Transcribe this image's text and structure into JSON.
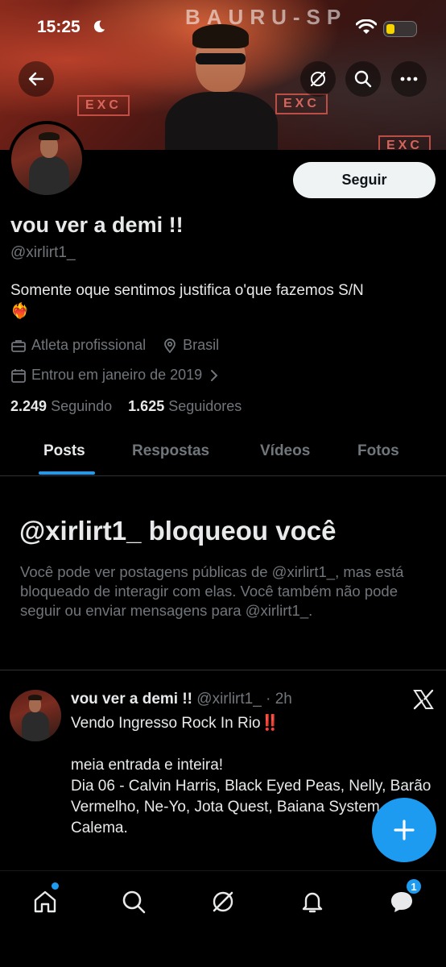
{
  "status_bar": {
    "time": "15:25"
  },
  "banner": {
    "text": "BAURU-SP",
    "signs": [
      "EXC",
      "EXC",
      "EXC"
    ]
  },
  "profile": {
    "follow_label": "Seguir",
    "display_name": "vou ver a demi !!",
    "handle": "@xirlirt1_",
    "bio": "Somente oque sentimos justifica o'que fazemos S/N",
    "bio_emoji": "❤️‍🔥",
    "profession": "Atleta profissional",
    "location": "Brasil",
    "joined": "Entrou em janeiro de 2019",
    "following_count": "2.249",
    "following_label": "Seguindo",
    "followers_count": "1.625",
    "followers_label": "Seguidores"
  },
  "tabs": [
    {
      "label": "Posts",
      "active": true
    },
    {
      "label": "Respostas",
      "active": false
    },
    {
      "label": "Vídeos",
      "active": false
    },
    {
      "label": "Fotos",
      "active": false
    }
  ],
  "blocked": {
    "title": "@xirlirt1_ bloqueou você",
    "text": "Você pode ver postagens públicas de @xirlirt1_, mas está bloqueado de interagir com elas. Você também não pode seguir ou enviar mensagens para @xirlirt1_."
  },
  "post": {
    "name": "vou ver a demi !!",
    "handle": "@xirlirt1_",
    "time": "· 2h",
    "body": "Vendo Ingresso Rock In Rio‼️\n\nmeia entrada e inteira!\nDia 06 - Calvin Harris, Black Eyed Peas, Nelly, Barão Vermelho, Ne-Yo, Jota Quest, Baiana System e Calema."
  },
  "nav": {
    "messages_badge": "1"
  },
  "colors": {
    "accent": "#1d9bf0",
    "background": "#000000",
    "muted": "#71767b"
  }
}
